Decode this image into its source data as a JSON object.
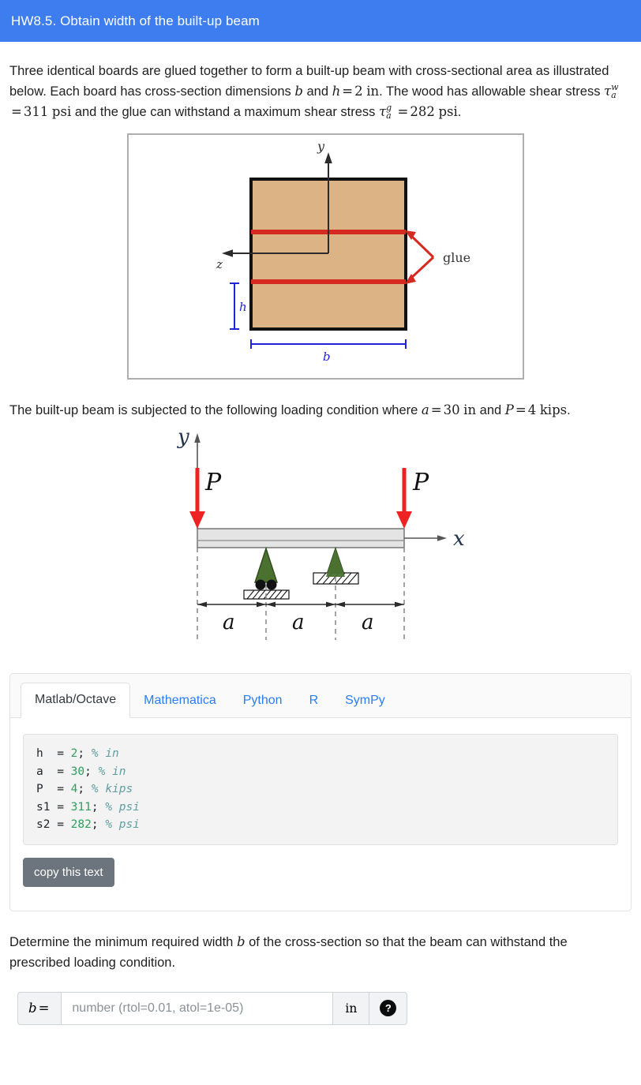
{
  "header": {
    "title": "HW8.5. Obtain width of the built-up beam",
    "bg": "#3d7df0"
  },
  "problem": {
    "p1_a": "Three identical boards are glued together to form a built-up beam with cross-sectional area as illustrated below. Each board has cross-section dimensions ",
    "sym_b": "b",
    "p1_b": " and ",
    "sym_h": "h",
    "eq": "=",
    "h_value": "2",
    "unit_in": "in",
    "p1_c": ". The wood has allowable shear stress ",
    "tau": "τ",
    "tau_w_sup": "w",
    "tau_sub_a": "a",
    "tau_w_value": "311",
    "unit_psi": "psi",
    "p1_d": " and the glue can withstand a maximum shear stress ",
    "tau_g_sup": "g",
    "tau_g_value": "282",
    "p1_e": ".",
    "p2_a": "The built-up beam is subjected to the following loading condition where ",
    "sym_a": "a",
    "a_value": "30",
    "p2_b": " and ",
    "sym_P": "P",
    "P_value": "4",
    "unit_kips": "kips",
    "p2_c": ".",
    "p3": "Determine the minimum required width ",
    "p3_b": " of the cross-section so that the beam can withstand the prescribed loading condition."
  },
  "figure_cross_section": {
    "axis_y": "y",
    "axis_z": "z",
    "dim_h": "h",
    "dim_b": "b",
    "glue_label": "glue",
    "wood_color": "#dcb384",
    "glue_color": "#d42a21",
    "dim_color": "#2222dd",
    "outline_color": "#111111"
  },
  "figure_beam": {
    "axis_y": "y",
    "axis_x": "x",
    "load_left": "P",
    "load_right": "P",
    "dim_1": "a",
    "dim_2": "a",
    "dim_3": "a",
    "arrow_color": "#ee2222",
    "support_color": "#4a7130",
    "beam_fill": "#e4e4e4"
  },
  "tabs": {
    "items": [
      {
        "label": "Matlab/Octave",
        "active": true
      },
      {
        "label": "Mathematica",
        "active": false
      },
      {
        "label": "Python",
        "active": false
      },
      {
        "label": "R",
        "active": false
      },
      {
        "label": "SymPy",
        "active": false
      }
    ],
    "code_lines": [
      {
        "assign": "h  = ",
        "value": "2",
        "semi": "; ",
        "comment": "% in"
      },
      {
        "assign": "a  = ",
        "value": "30",
        "semi": "; ",
        "comment": "% in"
      },
      {
        "assign": "P  = ",
        "value": "4",
        "semi": "; ",
        "comment": "% kips"
      },
      {
        "assign": "s1 = ",
        "value": "311",
        "semi": "; ",
        "comment": "% psi"
      },
      {
        "assign": "s2 = ",
        "value": "282",
        "semi": "; ",
        "comment": "% psi"
      }
    ],
    "copy_button": "copy this text"
  },
  "answer": {
    "label": "b =",
    "placeholder": "number (rtol=0.01, atol=1e-05)",
    "value": "",
    "unit": "in",
    "help": "?"
  }
}
